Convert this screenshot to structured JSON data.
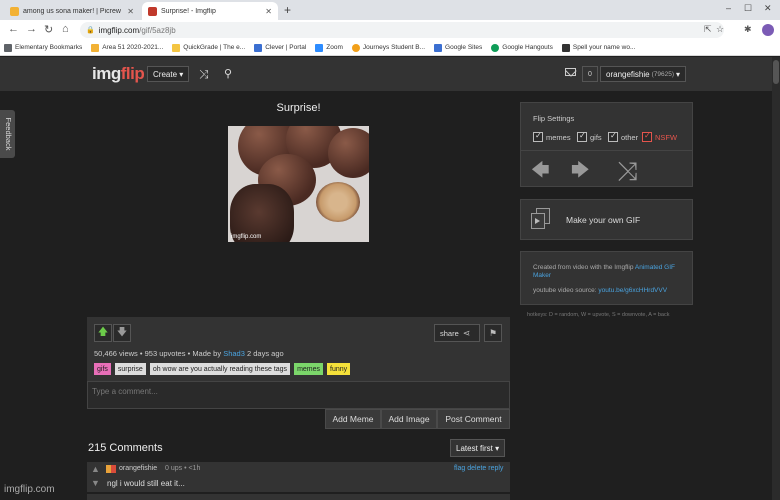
{
  "browser": {
    "tabs": [
      {
        "title": "among us sona maker! | Picrew",
        "favicon_color": "#f2b134"
      },
      {
        "title": "Surprise! - Imgflip",
        "favicon_color": "#c0392b"
      }
    ],
    "new_tab": "+",
    "url": {
      "host": "imgflip.com",
      "path": "/gif/5az8jb"
    },
    "bookmarks": [
      {
        "label": "Elementary Bookmarks",
        "icon_color": "#5f6368"
      },
      {
        "label": "Area 51 2020-2021...",
        "icon_color": "#f2b134"
      },
      {
        "label": "QuickGrade | The e...",
        "icon_color": "#f4c542"
      },
      {
        "label": "Clever | Portal",
        "icon_color": "#3b6fd1"
      },
      {
        "label": "Zoom",
        "icon_color": "#2d8cff"
      },
      {
        "label": "Journeys Student B...",
        "icon_color": "#f2a01a"
      },
      {
        "label": "Google Sites",
        "icon_color": "#3b6fd1"
      },
      {
        "label": "Google Hangouts",
        "icon_color": "#0f9d58"
      },
      {
        "label": "Spell your name wo...",
        "icon_color": "#333333"
      }
    ]
  },
  "header": {
    "logo_part1": "img",
    "logo_part2": "flip",
    "create_label": "Create ▾",
    "notification_count": "0",
    "username": "orangefishie",
    "user_points": "(79625)",
    "user_caret": "▾"
  },
  "feedback_label": "Feedback",
  "gif": {
    "title": "Surprise!",
    "watermark": "imgflip.com"
  },
  "actions": {
    "share_label": "share",
    "views": "50,466 views",
    "upvotes": "953 upvotes",
    "made_by_prefix": "Made by",
    "author": "Shad3",
    "age": "2 days ago",
    "tags": [
      {
        "label": "gifs",
        "color": "#e86fb8"
      },
      {
        "label": "surprise",
        "color": "#dddddd"
      },
      {
        "label": "oh wow are you actually reading these tags",
        "color": "#dddddd"
      },
      {
        "label": "memes",
        "color": "#7bd66a"
      },
      {
        "label": "funny",
        "color": "#f5e13a"
      }
    ]
  },
  "comment_form": {
    "placeholder": "Type a comment...",
    "add_meme": "Add Meme",
    "add_image": "Add Image",
    "post_comment": "Post Comment"
  },
  "comments": {
    "count_label": "215 Comments",
    "sort_label": "Latest first ▾",
    "items": [
      {
        "user": "orangefishie",
        "ups": "0 ups",
        "age": "<1h",
        "links": "flag delete reply",
        "text": "ngl i would still eat it..."
      }
    ]
  },
  "sidebar": {
    "flip_settings": {
      "title": "Flip Settings",
      "options": [
        "memes",
        "gifs",
        "other",
        "NSFW"
      ]
    },
    "make_gif_label": "Make your own GIF",
    "source": {
      "line1_prefix": "Created from video with the Imgflip",
      "line1_link": "Animated GIF Maker",
      "line2_prefix": "youtube video source:",
      "line2_link": "youtu.be/g6xcHHrdVVV"
    },
    "hotkeys": "hotkeys: D = random, W = upvote, S = downvote, A = back"
  },
  "page_watermark": "imgflip.com",
  "colors": {
    "accent_red": "#e4554d",
    "link_blue": "#4aa3df",
    "upvote_green": "#6ccb4a",
    "panel": "#333333",
    "page_bg": "#1f1f1f"
  }
}
